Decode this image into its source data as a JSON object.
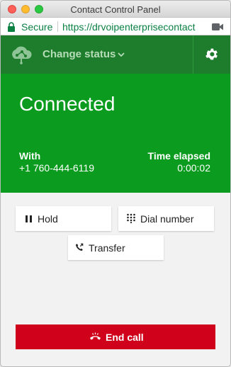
{
  "window": {
    "title": "Contact Control Panel"
  },
  "address_bar": {
    "secure_label": "Secure",
    "url": "https://drvoipenterprisecontact",
    "camera_icon": "video-camera-icon",
    "lock_icon": "lock-icon"
  },
  "header": {
    "status_label": "Change status",
    "logo_icon": "cloud-network-icon",
    "settings_icon": "gear-icon"
  },
  "call": {
    "state": "Connected",
    "with_label": "With",
    "phone_number": "+1 760-444-6119",
    "time_label": "Time elapsed",
    "time_value": "0:00:02"
  },
  "actions": {
    "hold_label": "Hold",
    "dial_label": "Dial number",
    "transfer_label": "Transfer",
    "end_call_label": "End call"
  },
  "colors": {
    "header_bg": "#1d7d2c",
    "connected_bg": "#0b9c1f",
    "end_call_bg": "#d0021b"
  }
}
